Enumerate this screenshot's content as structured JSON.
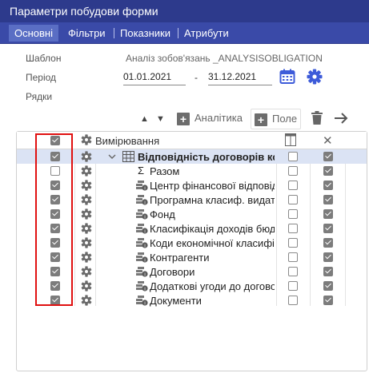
{
  "window": {
    "title": "Параметри побудови форми"
  },
  "tabs": [
    {
      "label": "Основні",
      "active": true
    },
    {
      "label": "Фільтри",
      "active": false
    },
    {
      "label": "Показники",
      "active": false
    },
    {
      "label": "Атрибути",
      "active": false
    }
  ],
  "form": {
    "template_label": "Шаблон",
    "template_value": "Аналіз зобов'язань _ANALYSISOBLIGATION",
    "period_label": "Період",
    "period_from": "01.01.2021",
    "period_sep": "-",
    "period_to": "31.12.2021",
    "rows_label": "Рядки"
  },
  "toolbar": {
    "add_analytics_label": "Аналітика",
    "add_field_label": "Поле",
    "icons": [
      "arrow-up-icon",
      "arrow-down-icon",
      "plus-icon",
      "trash-icon",
      "arrow-right-icon"
    ]
  },
  "grid": {
    "header": {
      "dimensions_label": "Вимірювання",
      "checked": true
    },
    "rows": [
      {
        "name": "Відповідність договорів коштор",
        "level": "group",
        "checked": true,
        "col_a": false,
        "col_b": true,
        "selected": true
      },
      {
        "name": "Разом",
        "level": "sum",
        "checked": false,
        "col_a": false,
        "col_b": true,
        "selected": false
      },
      {
        "name": "Центр фінансової відповідальн",
        "level": "item",
        "checked": true,
        "col_a": false,
        "col_b": true,
        "selected": false
      },
      {
        "name": "Програмна класиф. видатків",
        "level": "item",
        "checked": true,
        "col_a": false,
        "col_b": true,
        "selected": false
      },
      {
        "name": "Фонд",
        "level": "item",
        "checked": true,
        "col_a": false,
        "col_b": true,
        "selected": false
      },
      {
        "name": "Класифікація доходів бюджету",
        "level": "item",
        "checked": true,
        "col_a": false,
        "col_b": true,
        "selected": false
      },
      {
        "name": "Коди економічної класифікації",
        "level": "item",
        "checked": true,
        "col_a": false,
        "col_b": true,
        "selected": false
      },
      {
        "name": "Контрагенти",
        "level": "item",
        "checked": true,
        "col_a": false,
        "col_b": true,
        "selected": false
      },
      {
        "name": "Договори",
        "level": "item",
        "checked": true,
        "col_a": false,
        "col_b": true,
        "selected": false
      },
      {
        "name": "Додаткові угоди до договорів",
        "level": "item",
        "checked": true,
        "col_a": false,
        "col_b": true,
        "selected": false
      },
      {
        "name": "Документи",
        "level": "item",
        "checked": true,
        "col_a": false,
        "col_b": true,
        "selected": false
      }
    ]
  },
  "colors": {
    "titlebar": "#2d3a8c",
    "tabs": "#3a4aa8",
    "accent": "#3d5bd9",
    "highlight": "#e01010"
  }
}
